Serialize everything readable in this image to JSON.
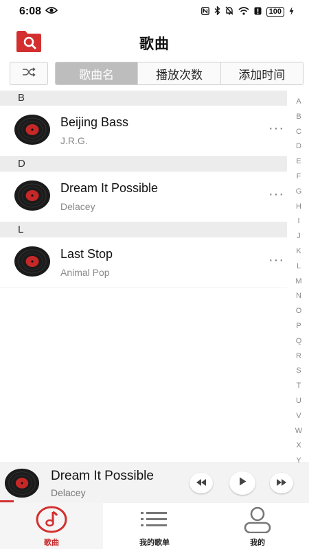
{
  "status_bar": {
    "time": "6:08",
    "battery": "100"
  },
  "header": {
    "title": "歌曲"
  },
  "sort_tabs": [
    {
      "label": "歌曲名",
      "active": true
    },
    {
      "label": "播放次数",
      "active": false
    },
    {
      "label": "添加时间",
      "active": false
    }
  ],
  "sections": [
    {
      "letter": "B",
      "songs": [
        {
          "title": "Beijing Bass",
          "artist": "J.R.G."
        }
      ]
    },
    {
      "letter": "D",
      "songs": [
        {
          "title": "Dream It Possible",
          "artist": "Delacey"
        }
      ]
    },
    {
      "letter": "L",
      "songs": [
        {
          "title": "Last Stop",
          "artist": "Animal Pop"
        }
      ]
    }
  ],
  "index_letters": [
    "A",
    "B",
    "C",
    "D",
    "E",
    "F",
    "G",
    "H",
    "I",
    "J",
    "K",
    "L",
    "M",
    "N",
    "O",
    "P",
    "Q",
    "R",
    "S",
    "T",
    "U",
    "V",
    "W",
    "X",
    "Y"
  ],
  "now_playing": {
    "title": "Dream It Possible",
    "artist": "Delacey"
  },
  "bottom_nav": [
    {
      "label": "歌曲",
      "icon": "music-note-icon",
      "active": true
    },
    {
      "label": "我的歌单",
      "icon": "playlist-icon",
      "active": false
    },
    {
      "label": "我的",
      "icon": "profile-icon",
      "active": false
    }
  ],
  "colors": {
    "accent": "#d32f2f",
    "disc_label": "#c62828"
  }
}
